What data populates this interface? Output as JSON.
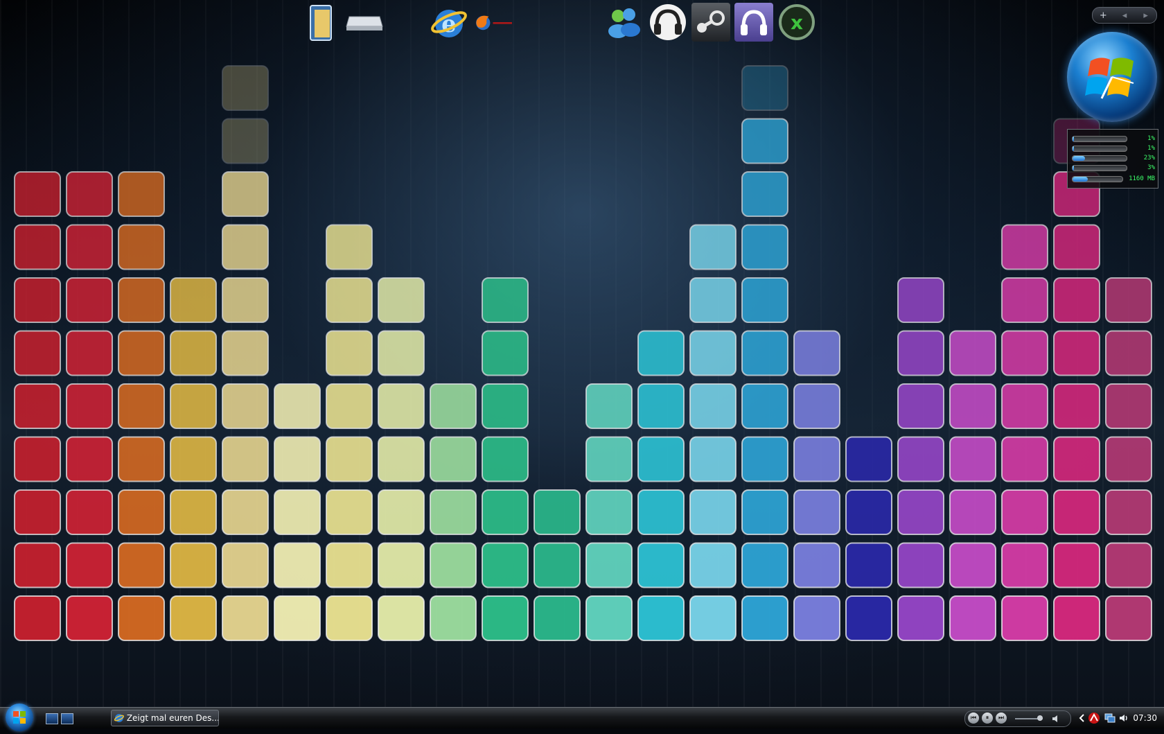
{
  "desktop": {
    "wallpaper": {
      "colors": {
        "columns": [
          "#c8202e",
          "#d02235",
          "#d66a22",
          "#e0b844",
          "#e8d690",
          "#f3f0b4",
          "#ede592",
          "#e6eeaa",
          "#9ee0a0",
          "#2dc08a",
          "#2bb98c",
          "#62d6c0",
          "#2dc4d6",
          "#7ad6ec",
          "#2ea6d8",
          "#7b80e0",
          "#2a28a8",
          "#9646c8",
          "#c64cc8",
          "#d83ca8",
          "#d8287e",
          "#b83a76"
        ]
      },
      "levels": [
        9,
        9,
        9,
        7,
        9,
        5,
        8,
        7,
        5,
        7,
        3,
        5,
        6,
        8,
        10,
        6,
        4,
        7,
        6,
        8,
        9,
        7
      ],
      "faded_caps": {
        "col_4": 2,
        "col_14": 1,
        "col_20": 1
      }
    },
    "dock_icons": [
      {
        "name": "documents-icon"
      },
      {
        "name": "drive-icon"
      },
      {
        "name": "internet-explorer-icon"
      },
      {
        "name": "firefox-icon"
      },
      {
        "name": "messenger-icon"
      },
      {
        "name": "headphones-icon"
      },
      {
        "name": "steam-icon"
      },
      {
        "name": "music-player-icon"
      },
      {
        "name": "xfire-icon"
      }
    ]
  },
  "sidebar": {
    "controls": {
      "add": "+",
      "prev": "◂",
      "next": "▸"
    },
    "meter": {
      "rows": [
        {
          "label_value": "1%",
          "fill": 0.01
        },
        {
          "label_value": "1%",
          "fill": 0.01
        },
        {
          "label_value": "23%",
          "fill": 0.23
        },
        {
          "label_value": "3%",
          "fill": 0.03
        },
        {
          "label_value": "1160 MB",
          "fill": 0.3
        }
      ]
    }
  },
  "taskbar": {
    "task_title": "Zeigt mal euren Des...",
    "clock": "07:30",
    "media": {
      "prev": "⏮",
      "pause": "⏸",
      "next": "⏭"
    }
  }
}
